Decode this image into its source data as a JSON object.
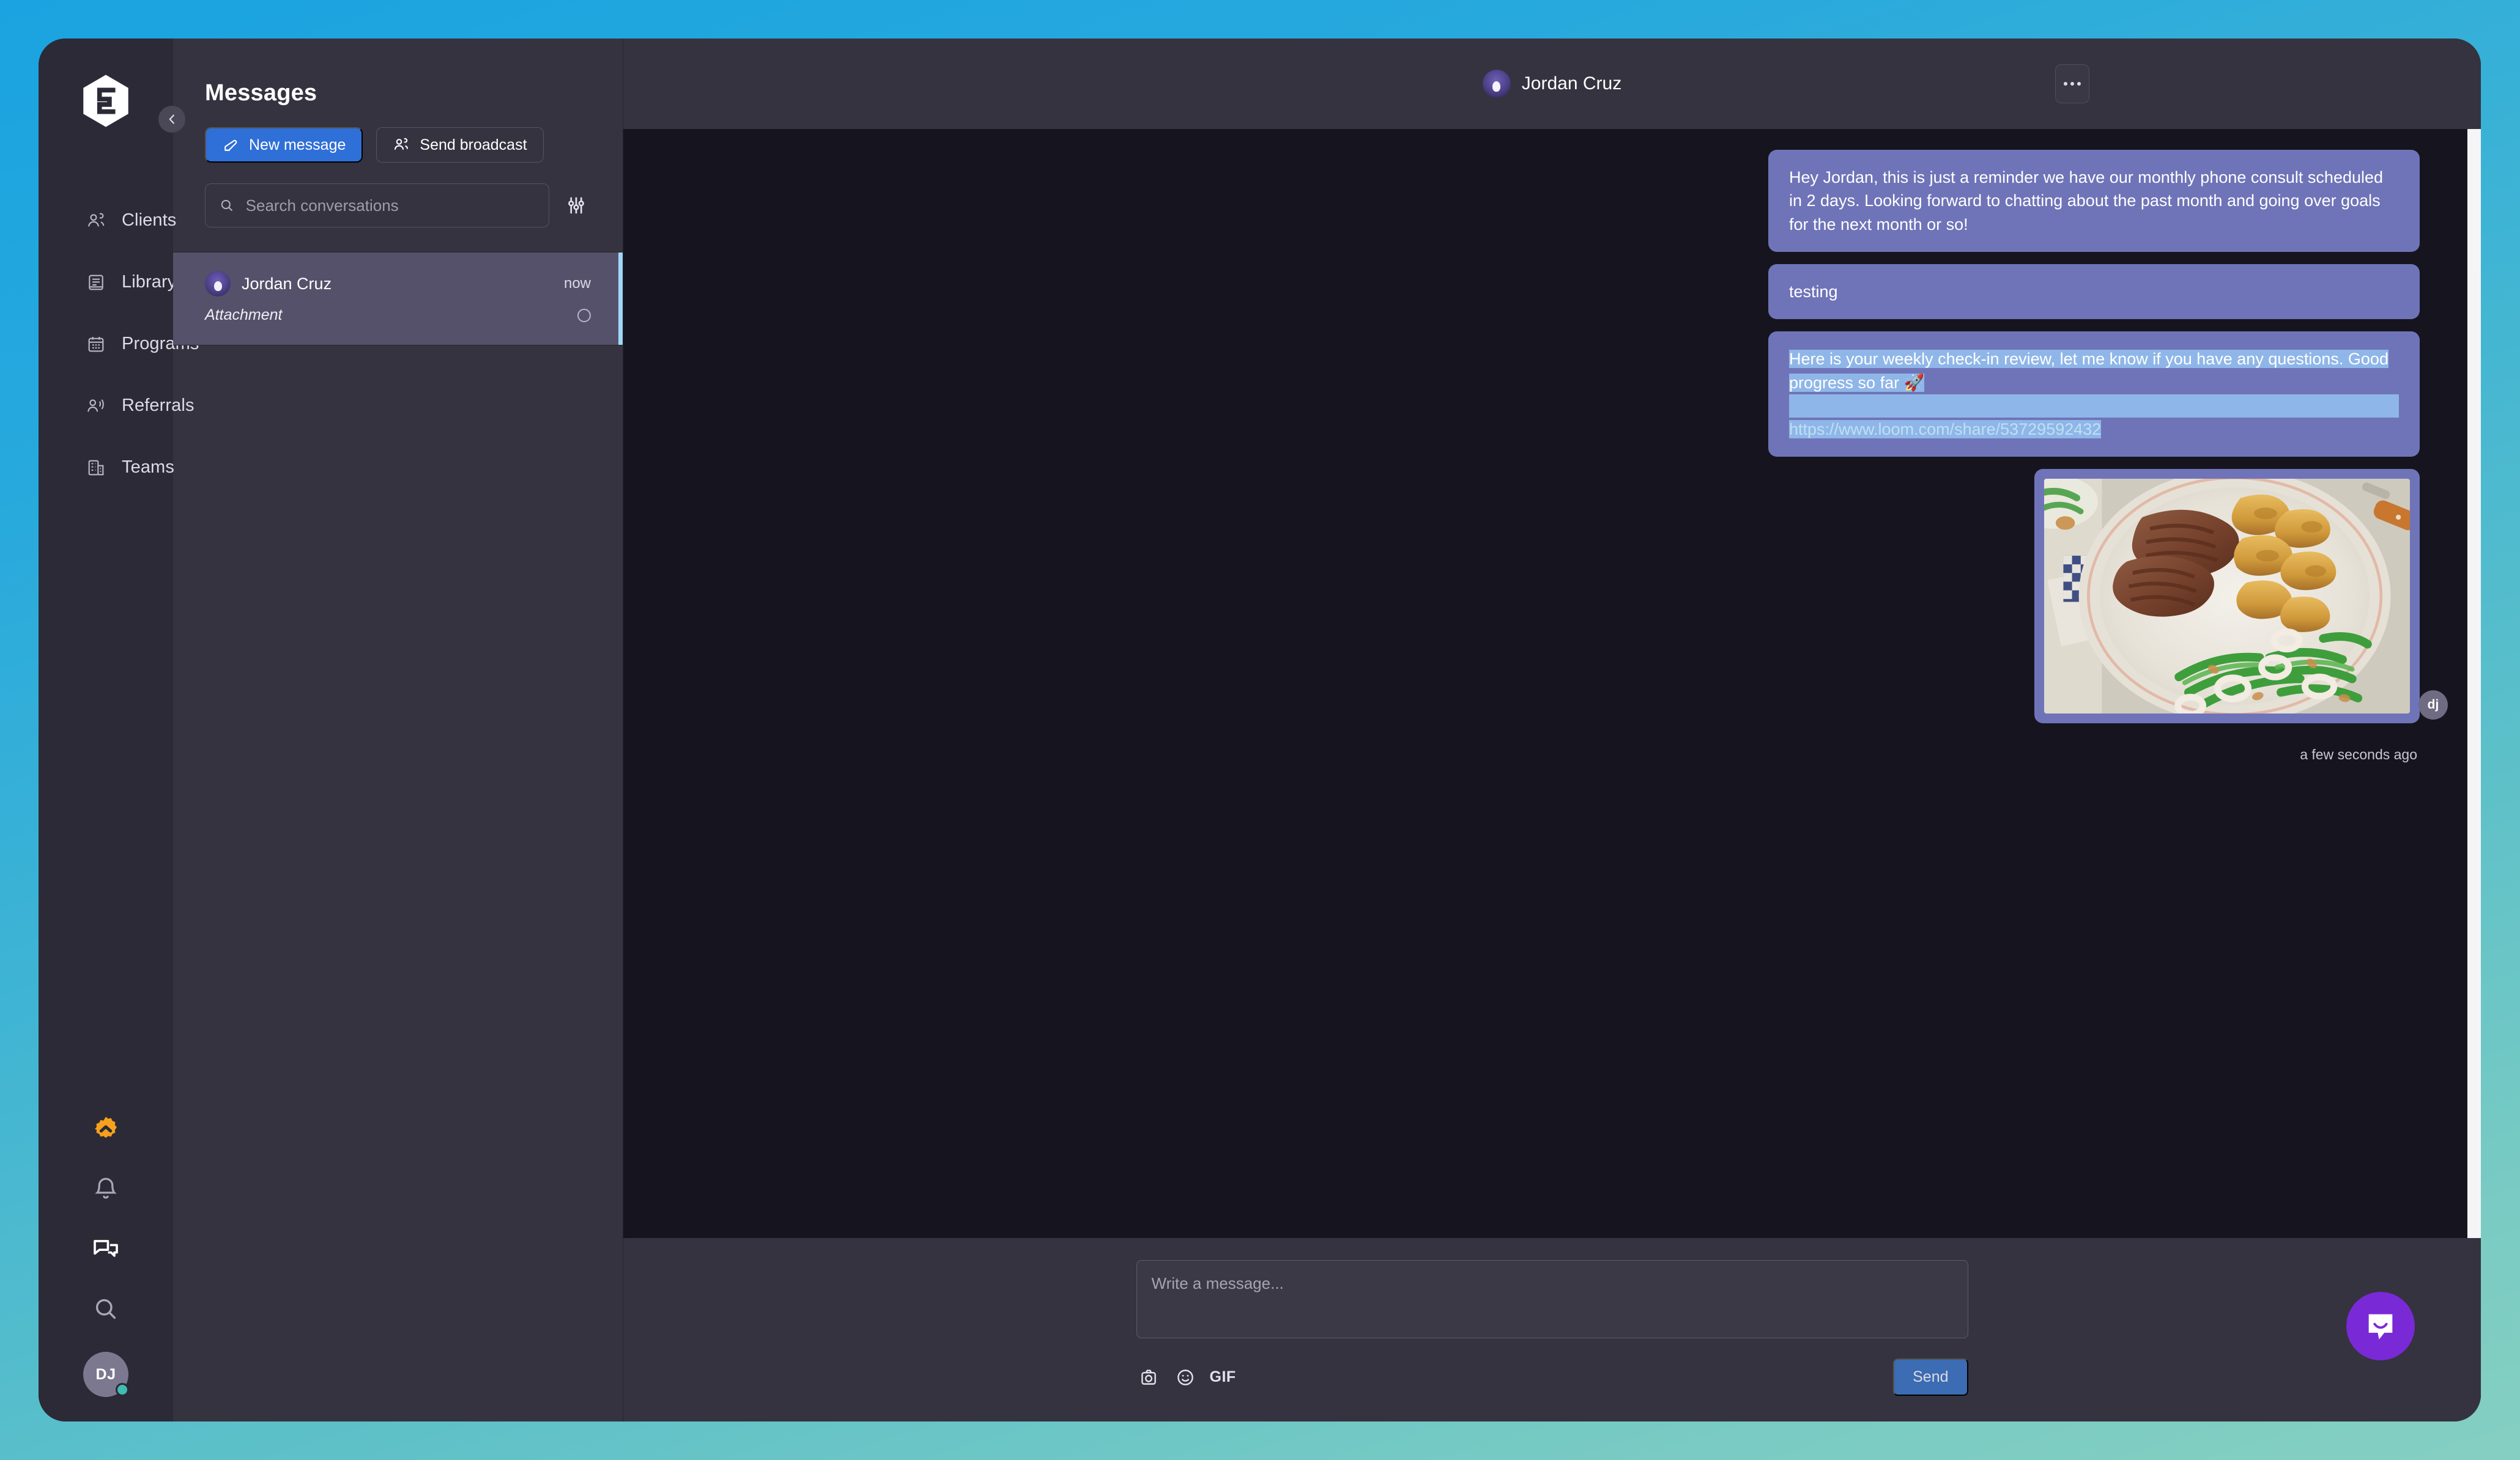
{
  "brand": {
    "logo_icon": "everfit-hexagon-logo"
  },
  "rail": {
    "items": [
      {
        "label": "Clients",
        "icon": "clients-people-icon"
      },
      {
        "label": "Library",
        "icon": "library-book-icon"
      },
      {
        "label": "Programs",
        "icon": "programs-calendar-icon"
      },
      {
        "label": "Referrals",
        "icon": "referrals-megaphone-person-icon"
      },
      {
        "label": "Teams",
        "icon": "teams-building-icon"
      }
    ],
    "bottom": {
      "upgrade_icon": "upgrade-badge-icon",
      "notifications_icon": "bell-icon",
      "messages_icon": "chat-bubbles-icon",
      "search_icon": "search-icon",
      "avatar_initials": "DJ",
      "avatar_status": "online"
    },
    "collapse_icon": "chevron-left-icon"
  },
  "conversations_panel": {
    "title": "Messages",
    "new_message_label": "New message",
    "new_message_icon": "compose-pencil-icon",
    "send_broadcast_label": "Send broadcast",
    "send_broadcast_icon": "broadcast-people-icon",
    "search_placeholder": "Search conversations",
    "search_value": "",
    "search_icon": "search-icon",
    "filter_icon": "filter-sliders-icon",
    "items": [
      {
        "name": "Jordan Cruz",
        "time": "now",
        "preview": "Attachment",
        "active": true,
        "avatar": "jordan-cruz-avatar"
      }
    ]
  },
  "chat": {
    "peer_name": "Jordan Cruz",
    "peer_avatar": "jordan-cruz-avatar",
    "menu_icon": "more-horizontal-icon",
    "messages": [
      {
        "type": "text",
        "text": "Hey Jordan, this is just a reminder we have our monthly phone consult scheduled in 2 days. Looking forward to chatting about the past month and going over goals for the next month or so!"
      },
      {
        "type": "text",
        "text": "testing"
      },
      {
        "type": "rich",
        "selected_text": "Here is your weekly check-in review, let me know if you have any questions. Good progress so far 🚀",
        "link_text": "https://www.loom.com/share/53729592432"
      },
      {
        "type": "attachment",
        "image_alt": "Plate of sliced steak with roasted potato wedges and green beans",
        "sender_initials": "dj",
        "timestamp": "a few seconds ago"
      }
    ]
  },
  "composer": {
    "placeholder": "Write a message...",
    "value": "",
    "camera_icon": "camera-icon",
    "emoji_icon": "emoji-smile-icon",
    "gif_label": "GIF",
    "send_label": "Send"
  },
  "support": {
    "launcher_icon": "intercom-chat-icon"
  },
  "colors": {
    "accent_blue": "#2f6fd8",
    "bubble": "#6f74b8",
    "selection": "#8fb6e8",
    "active_conv": "#55516a",
    "active_conv_marker": "#9fd7f5",
    "rail_bg": "#2b2a36",
    "panel_bg": "#35333f",
    "chat_bg": "#16151f",
    "intercom_purple": "#7a29d6",
    "online_green": "#3fbdb2",
    "upgrade_orange": "#f5a01e"
  }
}
